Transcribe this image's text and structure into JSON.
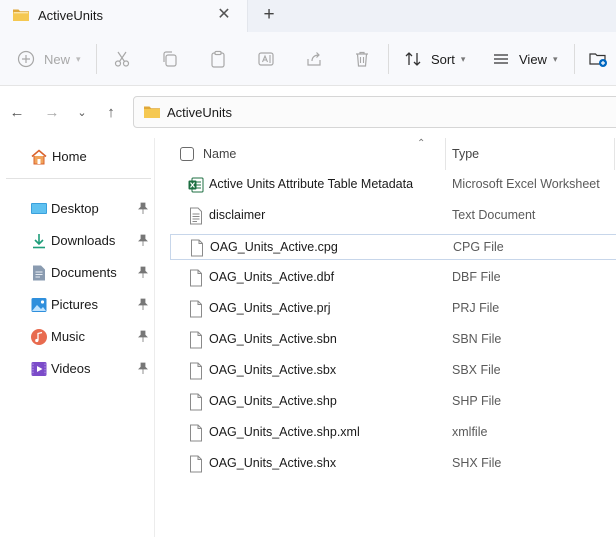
{
  "window": {
    "tab_title": "ActiveUnits",
    "close_glyph": "✕",
    "new_tab_glyph": "+"
  },
  "toolbar": {
    "new_label": "New",
    "sort_label": "Sort",
    "view_label": "View"
  },
  "address": {
    "path": "ActiveUnits"
  },
  "sidebar": {
    "home_label": "Home",
    "items": [
      {
        "label": "Desktop",
        "icon": "desktop-icon"
      },
      {
        "label": "Downloads",
        "icon": "downloads-icon"
      },
      {
        "label": "Documents",
        "icon": "documents-icon"
      },
      {
        "label": "Pictures",
        "icon": "pictures-icon"
      },
      {
        "label": "Music",
        "icon": "music-icon"
      },
      {
        "label": "Videos",
        "icon": "videos-icon"
      }
    ]
  },
  "columns": {
    "name": "Name",
    "type": "Type"
  },
  "files": [
    {
      "name": "Active Units Attribute Table Metadata",
      "type": "Microsoft Excel Worksheet",
      "icon": "excel-icon"
    },
    {
      "name": "disclaimer",
      "type": "Text Document",
      "icon": "text-file-icon"
    },
    {
      "name": "OAG_Units_Active.cpg",
      "type": "CPG File",
      "icon": "file-icon"
    },
    {
      "name": "OAG_Units_Active.dbf",
      "type": "DBF File",
      "icon": "file-icon"
    },
    {
      "name": "OAG_Units_Active.prj",
      "type": "PRJ File",
      "icon": "file-icon"
    },
    {
      "name": "OAG_Units_Active.sbn",
      "type": "SBN File",
      "icon": "file-icon"
    },
    {
      "name": "OAG_Units_Active.sbx",
      "type": "SBX File",
      "icon": "file-icon"
    },
    {
      "name": "OAG_Units_Active.shp",
      "type": "SHP File",
      "icon": "file-icon"
    },
    {
      "name": "OAG_Units_Active.shp.xml",
      "type": "xmlfile",
      "icon": "file-icon"
    },
    {
      "name": "OAG_Units_Active.shx",
      "type": "SHX File",
      "icon": "file-icon"
    }
  ],
  "colors": {
    "folder": "#f2c14e",
    "accent": "#0067c0",
    "excel": "#1d6f42"
  }
}
